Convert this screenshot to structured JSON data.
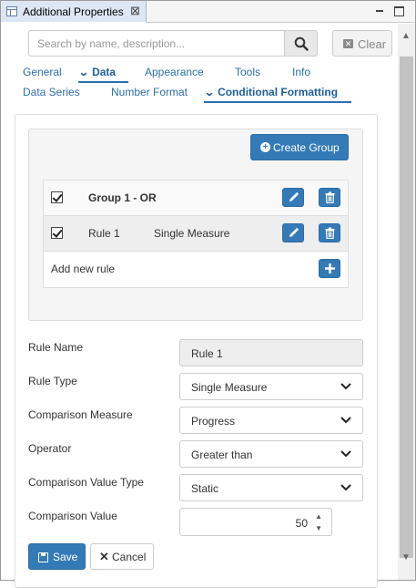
{
  "window": {
    "tab_title": "Additional Properties",
    "close_glyph": "⊠"
  },
  "search": {
    "placeholder": "Search by name, description...",
    "value": "",
    "clear_label": "Clear"
  },
  "tabs_row1": [
    {
      "label": "General",
      "active": false
    },
    {
      "label": "Data",
      "active": true
    },
    {
      "label": "Appearance",
      "active": false
    },
    {
      "label": "Tools",
      "active": false
    },
    {
      "label": "Info",
      "active": false
    }
  ],
  "tabs_row2": [
    {
      "label": "Data Series",
      "active": false
    },
    {
      "label": "Number Format",
      "active": false
    },
    {
      "label": "Conditional Formatting",
      "active": true
    }
  ],
  "groups": {
    "create_button": "Create Group",
    "group_row": {
      "label": "Group 1 - OR",
      "checked": true
    },
    "rule_row": {
      "name": "Rule 1",
      "type": "Single Measure",
      "checked": true
    },
    "add_rule_label": "Add new rule"
  },
  "form": {
    "rule_name": {
      "label": "Rule Name",
      "value": "Rule 1"
    },
    "rule_type": {
      "label": "Rule Type",
      "value": "Single Measure"
    },
    "comparison_measure": {
      "label": "Comparison Measure",
      "value": "Progress"
    },
    "operator": {
      "label": "Operator",
      "value": "Greater than"
    },
    "comparison_value_type": {
      "label": "Comparison Value Type",
      "value": "Static"
    },
    "comparison_value": {
      "label": "Comparison Value",
      "value": "50"
    }
  },
  "actions": {
    "save_label": "Save",
    "cancel_label": "Cancel"
  },
  "colors": {
    "primary": "#337ab7",
    "link": "#2c6fb0",
    "tab_bg": "#dde7f4"
  },
  "icons": [
    "table-icon",
    "close-icon",
    "minimize-icon",
    "maximize-icon",
    "search-icon",
    "clear-icon",
    "chevron-down-icon",
    "plus-circle-icon",
    "checkbox-icon",
    "pencil-icon",
    "trash-icon",
    "plus-icon",
    "save-icon",
    "times-icon",
    "spinner-up-icon",
    "spinner-down-icon"
  ]
}
